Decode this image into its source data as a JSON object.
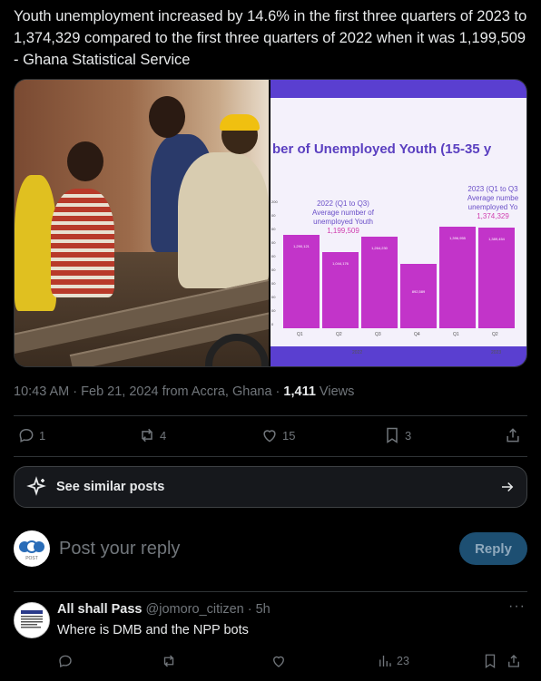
{
  "tweet": {
    "text": "Youth unemployment increased by 14.6% in the first three quarters of 2023 to 1,374,329 compared to the first three quarters of 2022 when it was 1,199,509 - Ghana Statistical Service"
  },
  "media": {
    "slide_title": "ber of Unemployed Youth (15-35 y",
    "note_2022_line1": "2022 (Q1 to Q3)",
    "note_2022_line2": "Average number of",
    "note_2022_line3": "unemployed Youth",
    "note_2022_value": "1,199,509",
    "note_2023_line1": "2023 (Q1 to Q3",
    "note_2023_line2": "Average numbe",
    "note_2023_line3": "unemployed Yo",
    "note_2023_value": "1,374,329",
    "bars": [
      {
        "q": "Q1",
        "value": 1290121,
        "label": "1,290,121"
      },
      {
        "q": "Q2",
        "value": 1044176,
        "label": "1,044,176"
      },
      {
        "q": "Q3",
        "value": 1264230,
        "label": "1,264,230"
      },
      {
        "q": "Q4",
        "value": 892589,
        "label": "892,589"
      },
      {
        "q": "Q1",
        "value": 1396955,
        "label": "1,396,955"
      },
      {
        "q": "Q2",
        "value": 1389454,
        "label": "1,389,454"
      }
    ],
    "year_2022": "2022",
    "year_2023": "2023",
    "y_ticks": [
      "200",
      "00",
      "00",
      "00",
      "00",
      "00",
      "00",
      "00",
      "00",
      "0"
    ]
  },
  "meta": {
    "time": "10:43 AM · Feb 21, 2024 from Accra, Ghana · ",
    "views_count": "1,411",
    "views_label": " Views"
  },
  "actions": {
    "replies": "1",
    "reposts": "4",
    "likes": "15",
    "bookmarks": "3"
  },
  "similar": {
    "label": "See similar posts"
  },
  "composer": {
    "placeholder": "Post your reply",
    "button": "Reply",
    "avatar_text": "TIO"
  },
  "reply": {
    "name": "All shall Pass",
    "handle": " @jomoro_citizen · 5h",
    "text": "Where is DMB and the NPP bots",
    "views": "23"
  },
  "colors": {
    "background": "#000000",
    "text": "#e7e9ea",
    "muted": "#71767b",
    "border": "#2f3336",
    "reply_button_bg": "#1d4f72",
    "chart_bar": "#c234c9",
    "slide_title": "#5a3fc0"
  }
}
